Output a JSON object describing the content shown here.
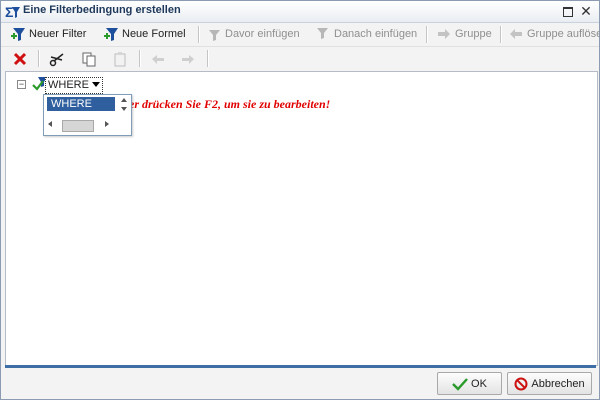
{
  "window": {
    "title": "Eine Filterbedingung erstellen",
    "controls": {
      "maximize_icon": "maximize-icon",
      "close_label": "✕"
    }
  },
  "toolbar1": {
    "items": [
      {
        "label": "Neuer Filter",
        "icon": "new-filter-icon",
        "enabled": true
      },
      {
        "label": "Neue Formel",
        "icon": "new-formula-icon",
        "enabled": true
      },
      {
        "label": "Davor einfügen",
        "icon": "insert-before-icon",
        "enabled": false
      },
      {
        "label": "Danach einfügen",
        "icon": "insert-after-icon",
        "enabled": false
      },
      {
        "label": "Gruppe",
        "icon": "group-icon",
        "enabled": false
      },
      {
        "label": "Gruppe auflöse",
        "icon": "ungroup-icon",
        "enabled": false
      }
    ]
  },
  "toolbar2": {
    "items": [
      {
        "icon": "delete-icon",
        "enabled": true
      },
      {
        "icon": "cut-icon",
        "enabled": true
      },
      {
        "icon": "copy-icon",
        "enabled": true
      },
      {
        "icon": "paste-icon",
        "enabled": false
      },
      {
        "icon": "undo-icon",
        "enabled": false
      },
      {
        "icon": "redo-icon",
        "enabled": false
      }
    ]
  },
  "tree": {
    "expander": "−",
    "where_value": "WHERE",
    "hint": "ken oder drücken Sie F2, um sie zu bearbeiten!"
  },
  "dropdown": {
    "options": [
      "WHERE"
    ],
    "selected": "WHERE"
  },
  "footer": {
    "ok_label": "OK",
    "cancel_label": "Abbrechen"
  },
  "colors": {
    "accent": "#3d6fa6",
    "hint_text": "#e00000",
    "selection": "#2f5f9e"
  }
}
